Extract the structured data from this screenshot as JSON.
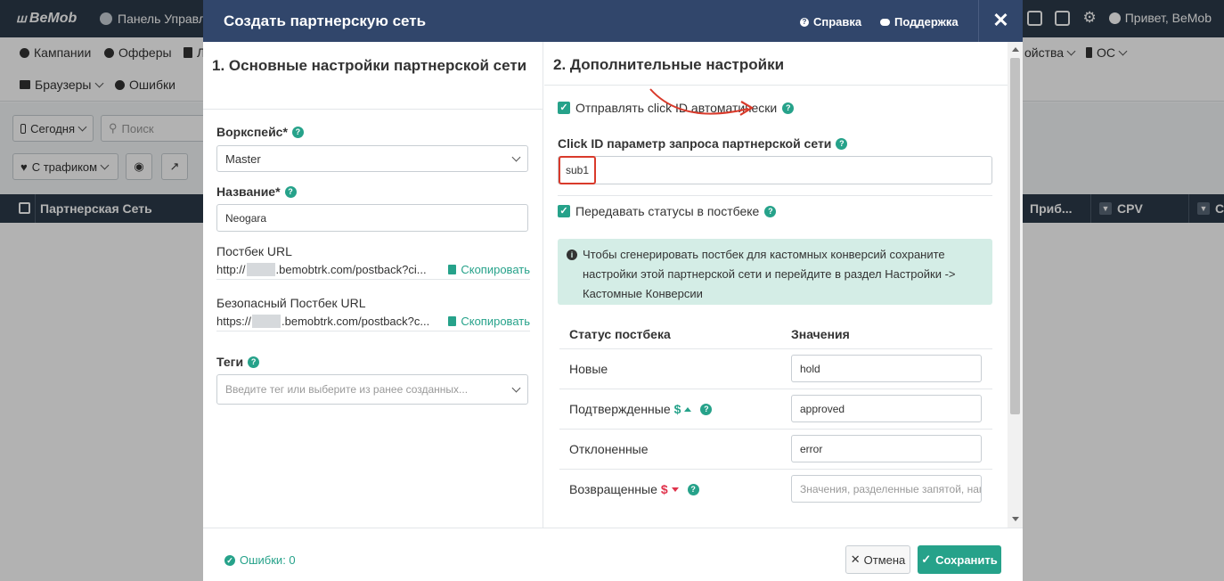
{
  "app": {
    "logo": "BeMob",
    "title": "Панель Управле",
    "greeting": "Привет, BeMob",
    "nav_row1": [
      "Кампании",
      "Офферы",
      "Л"
    ],
    "nav_row1_right": [
      "ойства",
      "ОС"
    ],
    "nav_row2": [
      "Браузеры",
      "Ошибки"
    ],
    "toolbar": {
      "date": "Сегодня",
      "search_placeholder": "Поиск",
      "traffic_filter": "С трафиком"
    },
    "grid_header": {
      "network_col": "Партнерская Сеть",
      "profit_col": "Приб...",
      "cpv_col": "CPV",
      "cp_col": "CP"
    }
  },
  "modal": {
    "title": "Создать партнерскую сеть",
    "help_link": "Справка",
    "support_link": "Поддержка",
    "close": "✕",
    "left": {
      "section_title": "1. Основные настройки партнерской сети",
      "workspace_label": "Воркспейс*",
      "workspace_value": "Master",
      "name_label": "Название*",
      "name_value": "Neogara",
      "postback_label": "Постбек URL",
      "postback_prefix": "http://",
      "postback_suffix": ".bemobtrk.com/postback?ci...",
      "secure_postback_label": "Безопасный Постбек URL",
      "secure_postback_prefix": "https://",
      "secure_postback_suffix": ".bemobtrk.com/postback?c...",
      "copy_label": "Скопировать",
      "tags_label": "Теги",
      "tags_placeholder": "Введите тег или выберите из ранее созданных..."
    },
    "right": {
      "section_title": "2. Дополнительные настройки",
      "send_clickid_label": "Отправлять click ID автоматически",
      "clickid_param_label": "Click ID параметр запроса партнерской сети",
      "clickid_param_value": "sub1",
      "pass_statuses_label": "Передавать статусы в постбеке",
      "info_text": "Чтобы сгенерировать постбек для кастомных конверсий сохраните настройки этой партнерской сети и перейдите в раздел Настройки -> Кастомные Конверсии",
      "table": {
        "col_status": "Статус постбека",
        "col_values": "Значения",
        "rows": [
          {
            "label": "Новые",
            "value": "hold",
            "placeholder": ""
          },
          {
            "label": "Подтвержденные",
            "value": "approved",
            "placeholder": ""
          },
          {
            "label": "Отклоненные",
            "value": "error",
            "placeholder": ""
          },
          {
            "label": "Возвращенные",
            "value": "",
            "placeholder": "Значения, разделенные запятой, нап"
          }
        ]
      }
    },
    "footer": {
      "errors": "Ошибки: 0",
      "cancel": "Отмена",
      "save": "Сохранить"
    }
  },
  "colors": {
    "header": "#31466b",
    "accent": "#26a28a",
    "info_bg": "#d4ede6",
    "highlight": "#d93a2b",
    "negative": "#e0334c"
  }
}
